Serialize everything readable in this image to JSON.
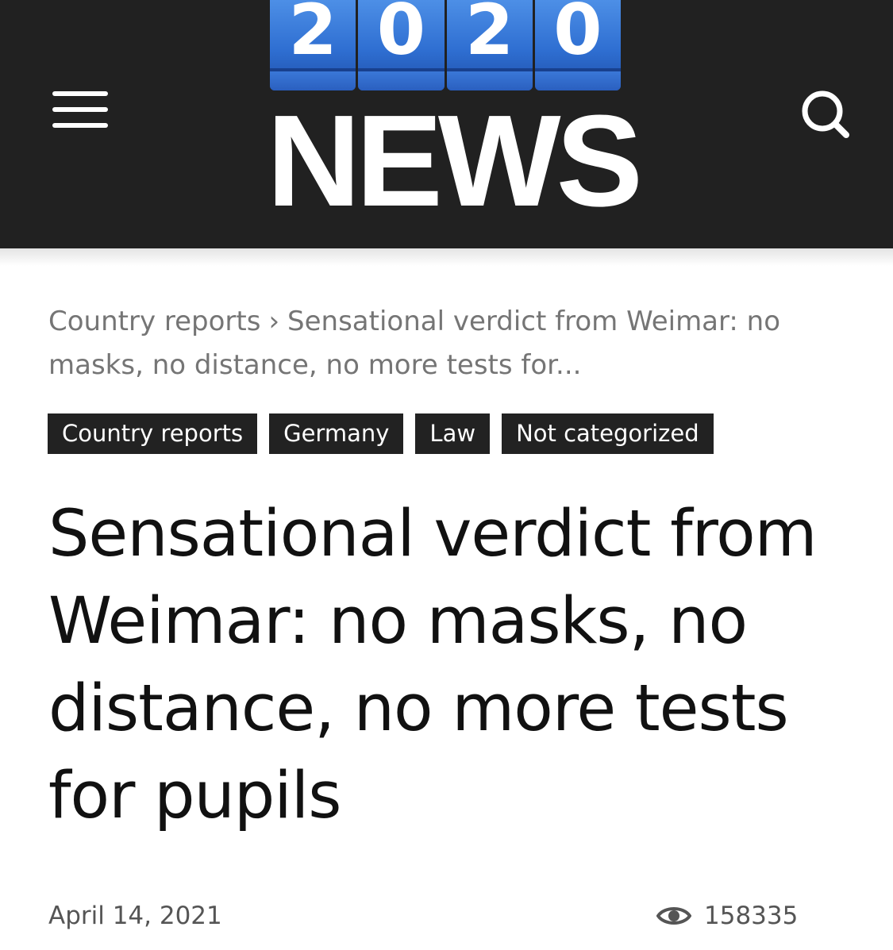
{
  "header": {
    "logo": {
      "digits": [
        "2",
        "0",
        "2",
        "0"
      ],
      "word": "NEWS"
    },
    "menu_icon": "hamburger-menu-icon",
    "search_icon": "search-icon",
    "background_color": "#212121"
  },
  "breadcrumb": {
    "parent": "Country reports",
    "separator": "›",
    "current": "Sensational verdict from Weimar: no masks, no distance, no more tests for..."
  },
  "tags": [
    "Country reports",
    "Germany",
    "Law",
    "Not categorized"
  ],
  "article": {
    "title": "Sensational verdict from Weimar: no masks, no distance, no more tests for pupils",
    "date": "April 14, 2021",
    "views_icon": "eye-icon",
    "views": "158335"
  },
  "colors": {
    "logo_blue": "#2f6fd2",
    "tag_background": "#222222",
    "meta_text": "#757575"
  }
}
